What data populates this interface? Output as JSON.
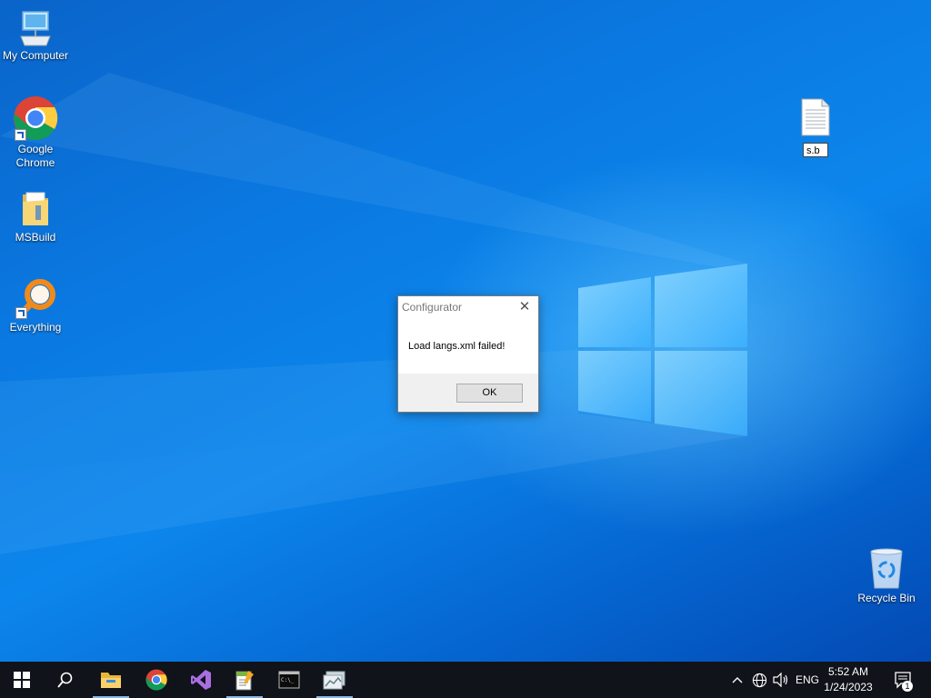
{
  "desktop": {
    "icons": [
      {
        "label": "My Computer",
        "icon": "computer-icon"
      },
      {
        "label": "Google Chrome",
        "icon": "chrome-icon"
      },
      {
        "label": "MSBuild",
        "icon": "folder-icon"
      },
      {
        "label": "Everything",
        "icon": "everything-search-icon"
      },
      {
        "label": "Recycle Bin",
        "icon": "recycle-bin-icon"
      }
    ],
    "renaming_file": {
      "value": "s.b",
      "icon": "text-file-icon"
    }
  },
  "dialog": {
    "title": "Configurator",
    "message": "Load langs.xml failed!",
    "ok_label": "OK",
    "close_icon": "close-icon"
  },
  "taskbar": {
    "pinned": [
      {
        "name": "start",
        "icon": "windows-start-icon"
      },
      {
        "name": "search",
        "icon": "search-icon"
      },
      {
        "name": "file-explorer",
        "icon": "file-explorer-icon",
        "active": true
      },
      {
        "name": "chrome",
        "icon": "chrome-icon"
      },
      {
        "name": "visual-studio",
        "icon": "visual-studio-icon"
      },
      {
        "name": "editor",
        "icon": "notepad-icon",
        "active": true
      },
      {
        "name": "command-prompt",
        "icon": "terminal-icon"
      },
      {
        "name": "app",
        "icon": "app-window-icon",
        "active": true
      }
    ],
    "tray": {
      "chevron_icon": "chevron-up-icon",
      "network_icon": "globe-icon",
      "volume_icon": "speaker-icon",
      "language": "ENG",
      "time": "5:52 AM",
      "date": "1/24/2023",
      "notification_count": "1"
    }
  },
  "colors": {
    "desktop_blue": "#0a78e0",
    "taskbar": "#101319",
    "accent": "#8bb6e8"
  }
}
